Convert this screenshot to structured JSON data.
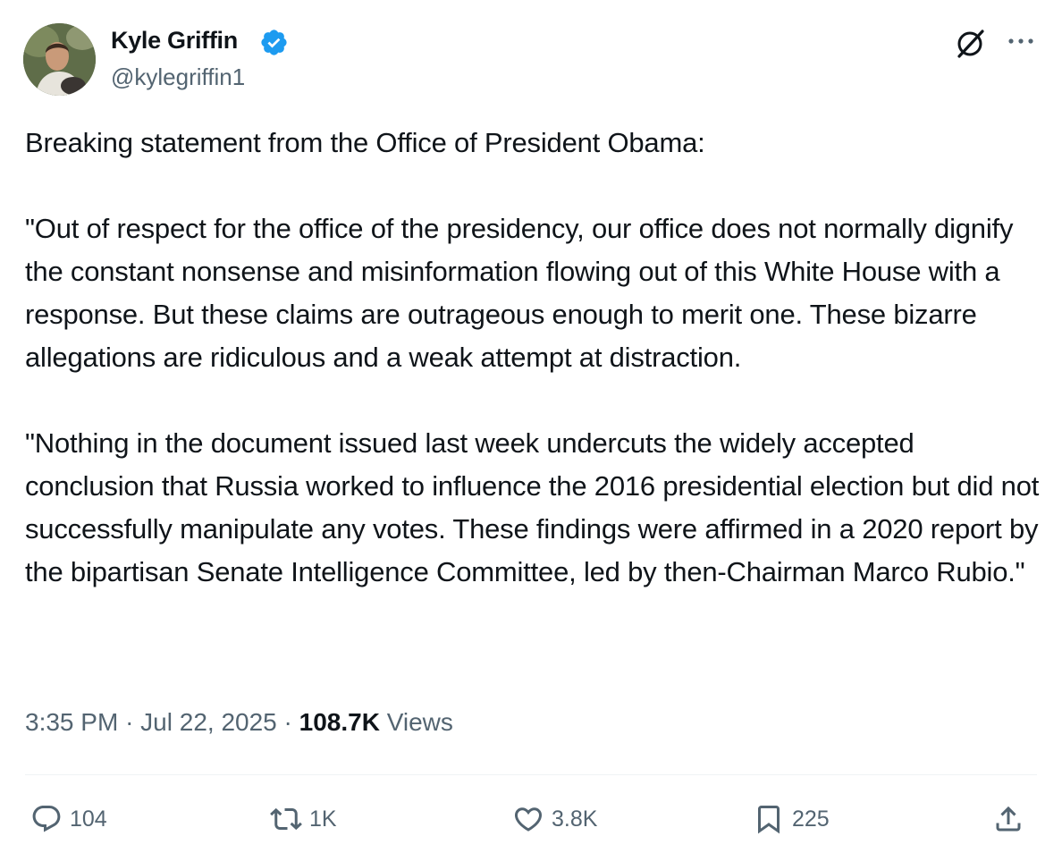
{
  "author": {
    "display_name": "Kyle Griffin",
    "handle": "@kylegriffin1",
    "verified": true
  },
  "tweet": {
    "paragraphs": [
      "Breaking statement from the Office of President Obama:",
      "\"Out of respect for the office of the presidency, our office does not normally dignify the constant nonsense and misinformation flowing out of this White House with a response. But these claims are outrageous enough to merit one. These bizarre allegations are ridiculous and a weak attempt at distraction.",
      "\"Nothing in the document issued last week undercuts the widely accepted conclusion that Russia worked to influence the 2016 presidential election but did not successfully manipulate any votes. These findings were affirmed in a 2020 report by the bipartisan Senate Intelligence Committee, led by then-Chairman Marco Rubio.\""
    ]
  },
  "meta": {
    "time": "3:35 PM",
    "date": "Jul 22, 2025",
    "separator": "·",
    "views_count": "108.7K",
    "views_label": "Views"
  },
  "actions": {
    "replies": "104",
    "reposts": "1K",
    "likes": "3.8K",
    "bookmarks": "225"
  },
  "icons": {
    "verified": "verified-badge-icon",
    "grok": "grok-icon",
    "more": "more-icon",
    "reply": "reply-icon",
    "repost": "repost-icon",
    "like": "heart-icon",
    "bookmark": "bookmark-icon",
    "share": "share-icon"
  },
  "colors": {
    "text": "#0f1419",
    "secondary": "#536471",
    "verified": "#1d9bf0",
    "divider": "#eff3f4"
  }
}
